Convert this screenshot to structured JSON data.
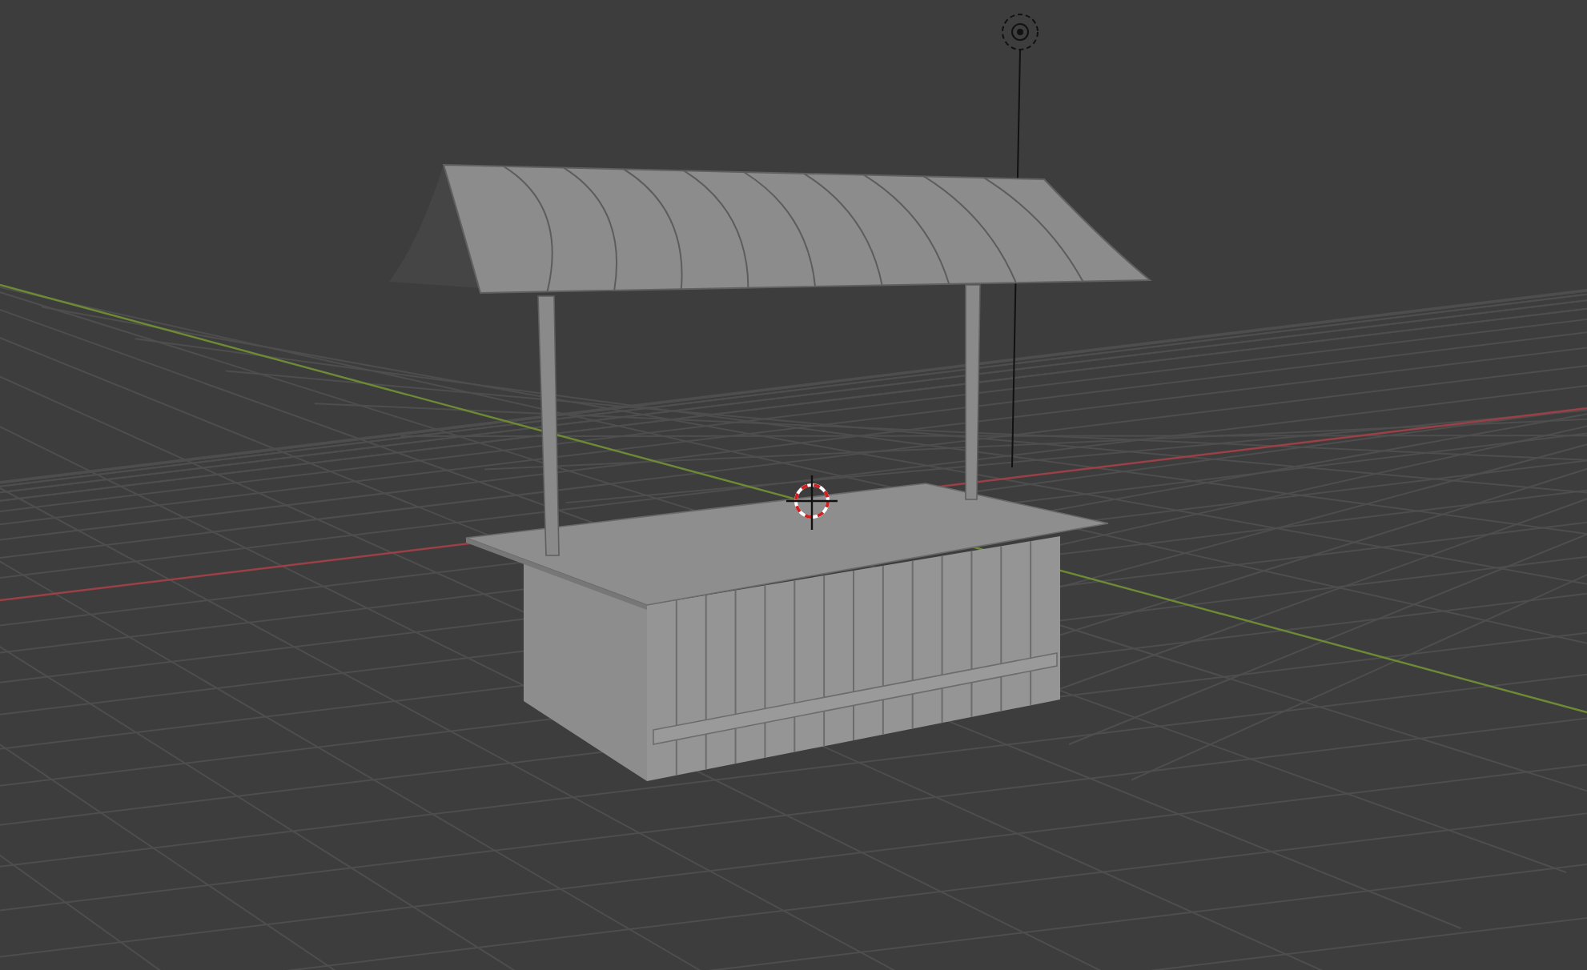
{
  "viewport": {
    "show_grid": true,
    "show_axes": true,
    "show_cursor": true,
    "show_light": true,
    "show_model": true
  }
}
